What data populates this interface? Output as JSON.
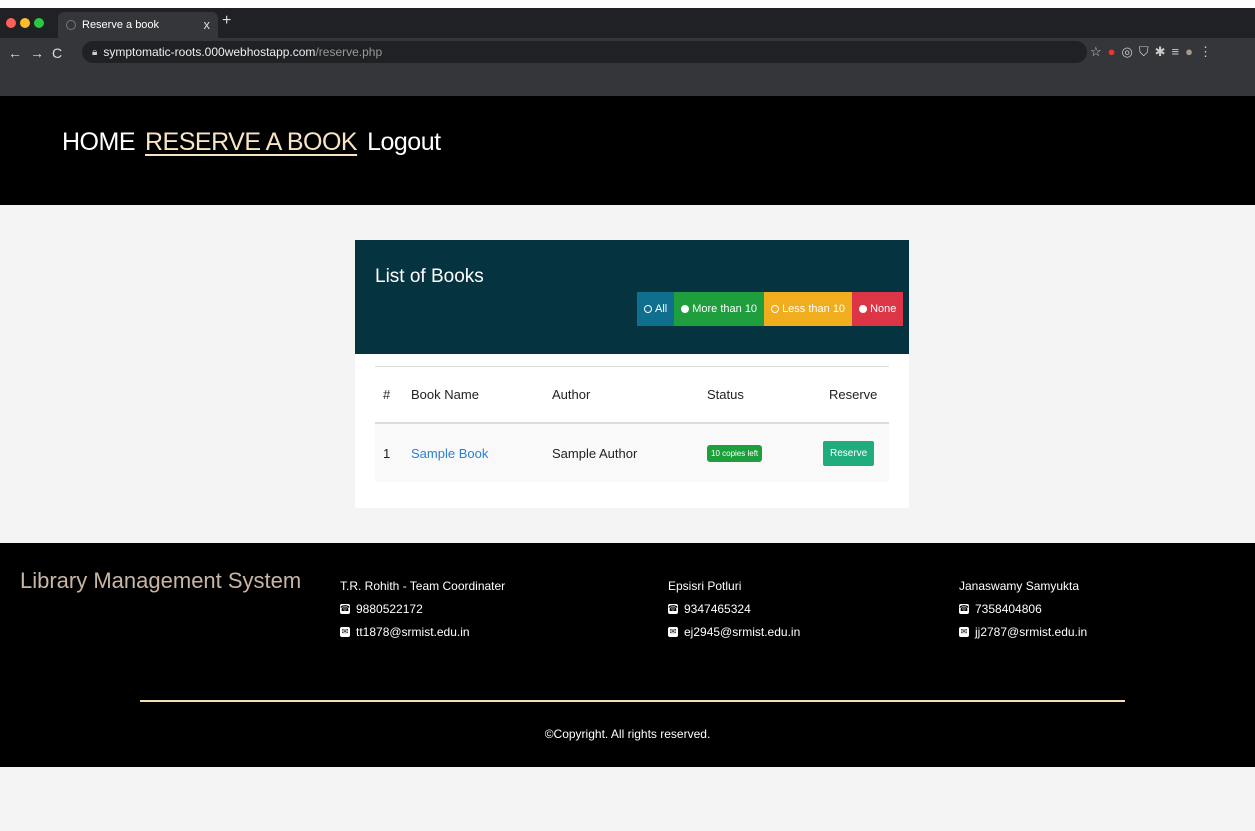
{
  "browser": {
    "tab_title": "Reserve a book",
    "tab_close": "x",
    "new_tab": "+",
    "url_host": "symptomatic-roots.000webhostapp.com",
    "url_path": "/reserve.php"
  },
  "nav": {
    "home": "HOME",
    "reserve": "RESERVE A BOOK",
    "logout": "Logout"
  },
  "card": {
    "title": "List of Books",
    "filters": [
      {
        "label": "All",
        "bg": "#0e6f8f",
        "dot": "#ffffff",
        "dot_style": "ring"
      },
      {
        "label": "More than 10",
        "bg": "#1e9e3c",
        "dot": "#ffffff",
        "dot_style": "fill"
      },
      {
        "label": "Less than 10",
        "bg": "#f0ad1e",
        "dot": "#ffffff",
        "dot_style": "ring"
      },
      {
        "label": "None",
        "bg": "#dc3545",
        "dot": "#ffffff",
        "dot_style": "fill"
      }
    ],
    "columns": [
      "#",
      "Book Name",
      "Author",
      "Status",
      "Reserve"
    ],
    "rows": [
      {
        "num": "1",
        "book": "Sample Book",
        "author": "Sample Author",
        "status": "10 copies left",
        "action": "Reserve"
      }
    ]
  },
  "footer": {
    "brand": "Library Management System",
    "contacts": [
      {
        "name": "T.R. Rohith - Team Coordinater",
        "phone": "9880522172",
        "email": "tt1878@srmist.edu.in"
      },
      {
        "name": "Epsisri Potluri",
        "phone": "9347465324",
        "email": "ej2945@srmist.edu.in"
      },
      {
        "name": "Janaswamy Samyukta",
        "phone": "7358404806",
        "email": "jj2787@srmist.edu.in"
      }
    ],
    "copyright": "©Copyright. All rights reserved."
  },
  "colors": {
    "header_bg": "#000000",
    "card_head_bg": "#063340",
    "footer_bg": "#000000"
  }
}
